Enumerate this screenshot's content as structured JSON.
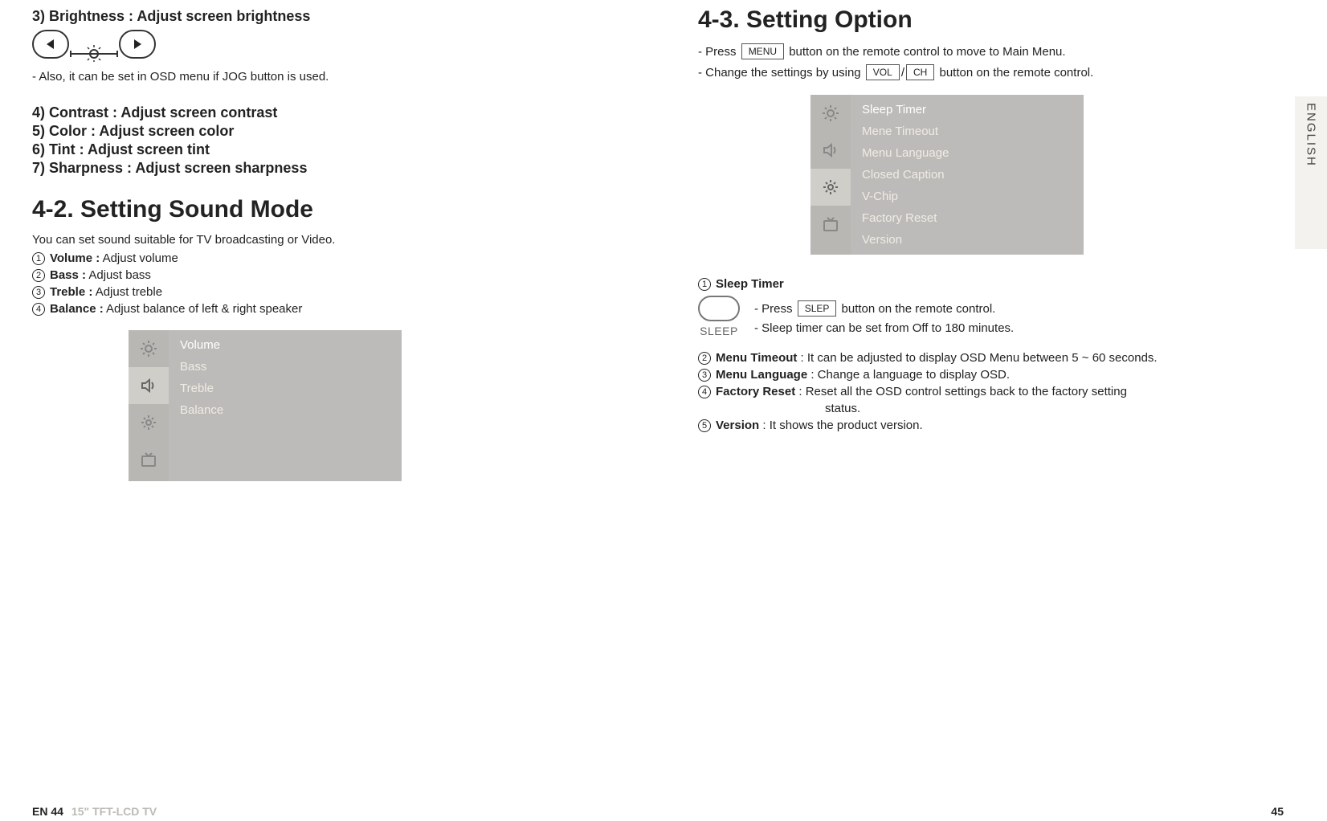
{
  "left": {
    "item3": "3) Brightness : Adjust screen brightness",
    "dial_note": "- Also, it can be set in OSD menu if JOG button is used.",
    "item4": "4) Contrast : Adjust screen contrast",
    "item5": "5) Color : Adjust screen color",
    "item6": "6) Tint : Adjust screen tint",
    "item7": "7) Sharpness : Adjust screen sharpness",
    "section42": "4-2. Setting Sound Mode",
    "section42_intro": "You can set sound suitable for TV broadcasting or Video.",
    "list": {
      "n1": "1",
      "l1_term": "Volume :",
      "l1_desc": " Adjust volume",
      "n2": "2",
      "l2_term": "Bass :",
      "l2_desc": " Adjust bass",
      "n3": "3",
      "l3_term": "Treble :",
      "l3_desc": " Adjust treble",
      "n4": "4",
      "l4_term": "Balance :",
      "l4_desc": " Adjust balance of left & right speaker"
    },
    "osd": {
      "volume": "Volume",
      "bass": "Bass",
      "treble": "Treble",
      "balance": "Balance"
    }
  },
  "right": {
    "section43": "4-3. Setting Option",
    "intro1_a": "- Press ",
    "key_menu": "MENU",
    "intro1_b": " button on the remote control to move to Main Menu.",
    "intro2_a": "- Change the settings by using ",
    "key_vol": "VOL",
    "slash": "/",
    "key_ch": "CH",
    "intro2_b": " button on the remote control.",
    "osd": {
      "sleep": "Sleep Timer",
      "timeout": "Mene Timeout",
      "language": "Menu Language",
      "caption": "Closed Caption",
      "vchip": "V-Chip",
      "factory": "Factory Reset",
      "version": "Version"
    },
    "list": {
      "n1": "1",
      "l1_term": "Sleep Timer",
      "sleep_caption": "SLEEP",
      "sleep_line1_a": "- Press ",
      "key_slep": "SLEP",
      "sleep_line1_b": " button on the remote control.",
      "sleep_line2": "- Sleep timer can be set from Off to 180 minutes.",
      "n2": "2",
      "l2_term": "Menu Timeout",
      "l2_desc": " : It can be adjusted to display OSD Menu between 5 ~ 60 seconds.",
      "n3": "3",
      "l3_term": "Menu Language",
      "l3_desc": " : Change a language to display OSD.",
      "n4": "4",
      "l4_term": "Factory Reset",
      "l4_desc": " : Reset all the OSD control settings back to the factory setting",
      "l4_desc_cont": "status.",
      "n5": "5",
      "l5_term": "Version",
      "l5_desc": " : It shows the product version."
    }
  },
  "side_tab": "ENGLISH",
  "footer": {
    "left_page": "EN 44",
    "product": "15\" TFT-LCD TV",
    "right_page": "45"
  }
}
